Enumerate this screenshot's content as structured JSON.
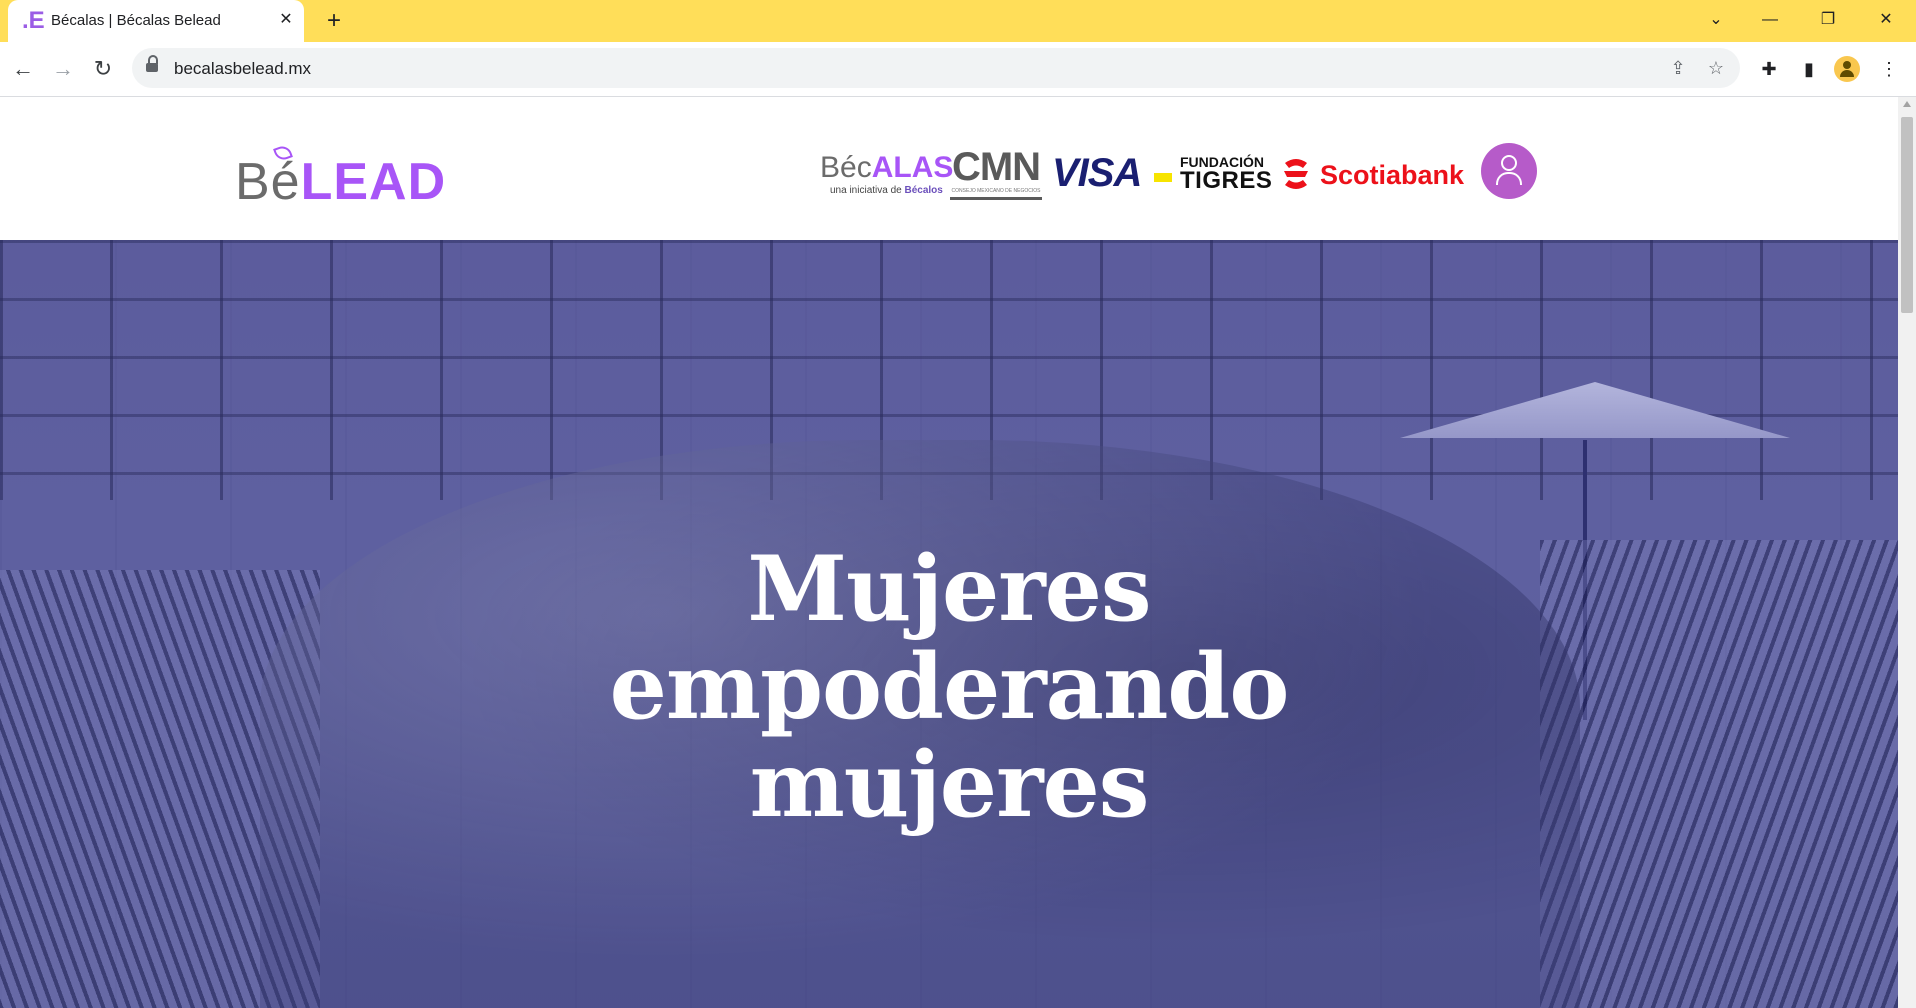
{
  "browser": {
    "tab": {
      "favicon": ".E",
      "title": "Bécalas | Bécalas Belead",
      "close": "✕"
    },
    "new_tab": "+",
    "window": {
      "dropdown": "⌄",
      "minimize": "—",
      "restore": "❐",
      "close": "✕"
    },
    "nav": {
      "back": "←",
      "forward": "→",
      "reload": "↻"
    },
    "url": "becalasbelead.mx",
    "omnibox_icons": {
      "share": "⇪",
      "bookmark": "☆"
    },
    "toolbar_icons": {
      "extensions": "✚",
      "side_panel": "▮",
      "menu": "⋮"
    }
  },
  "header": {
    "logo": {
      "be": "Bé",
      "lead": "LEAD"
    },
    "partners": {
      "becalas": {
        "bec": "Béc",
        "alas": "ALAS",
        "sub_prefix": "una iniciativa de ",
        "sub_brand": "Bécalos"
      },
      "cmn": {
        "main": "CMN",
        "sub": "CONSEJO MEXICANO DE NEGOCIOS"
      },
      "visa": "VISA",
      "tigres": {
        "top": "FUNDACIÓN",
        "main": "TIGRES"
      },
      "scotiabank": "Scotiabank"
    }
  },
  "hero": {
    "title_lines": [
      "Mujeres",
      "empoderando",
      "mujeres"
    ]
  },
  "colors": {
    "tabbar": "#ffde59",
    "brand_purple": "#a855f7",
    "user_button": "#b65bc9",
    "visa_blue": "#1a1f71",
    "scotiabank_red": "#ec111a",
    "hero_overlay": "#5a5a9b"
  },
  "icons": {
    "user": "user-icon",
    "lock": "lock-icon"
  }
}
